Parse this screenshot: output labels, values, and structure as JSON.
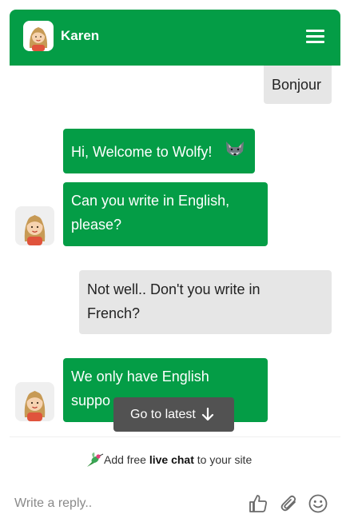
{
  "header": {
    "agent_name": "Karen"
  },
  "messages": [
    {
      "from": "user",
      "text": "Bonjour"
    },
    {
      "from": "agent",
      "text": "Hi, Welcome to Wolfy!"
    },
    {
      "from": "agent",
      "line1": "Can you write in English,",
      "line2": "please?"
    },
    {
      "from": "user",
      "line1": "Not well.. Don't you write in",
      "line2": "French?"
    },
    {
      "from": "agent",
      "line1": "We only have English",
      "line2": "suppo"
    }
  ],
  "go_to_latest": "Go to latest",
  "promo": {
    "before": "Add free ",
    "bold": "live chat",
    "after": " to your site"
  },
  "reply": {
    "placeholder": "Write a reply.."
  },
  "icons": {
    "menu": "hamburger-menu-icon",
    "wolf": "wolf-emoji-icon",
    "arrow": "arrow-down-icon",
    "promo": "hummingbird-icon",
    "like": "thumbs-up-icon",
    "attach": "paperclip-icon",
    "emoji": "smiley-icon"
  },
  "colors": {
    "brand": "#049d46",
    "user_bubble": "#e6e6e6",
    "toast": "#525252"
  }
}
